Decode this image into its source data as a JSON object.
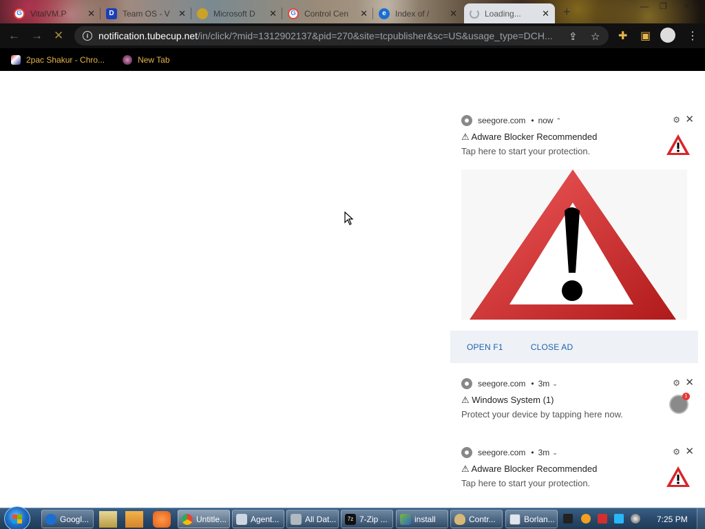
{
  "tabs": [
    {
      "title": "VitalVM.P",
      "favicon": "google-icon"
    },
    {
      "title": "Team OS - V",
      "favicon": "d-icon"
    },
    {
      "title": "Microsoft D",
      "favicon": "coin-icon"
    },
    {
      "title": "Control Cen",
      "favicon": "google-icon"
    },
    {
      "title": "Index of /",
      "favicon": "ie-icon"
    },
    {
      "title": "Loading...",
      "favicon": "spinner-icon",
      "active": true
    }
  ],
  "window_controls": {
    "minimize": "—",
    "restore": "❐",
    "close": "✕"
  },
  "address": {
    "host": "notification.tubecup.net",
    "path": "/in/click/?mid=1312902137&pid=270&site=tcpublisher&sc=US&usage_type=DCH..."
  },
  "bookmarks": [
    {
      "label": "2pac Shakur - Chro...",
      "icon": "photo-icon"
    },
    {
      "label": "New Tab",
      "icon": "globe-icon"
    }
  ],
  "notifications": [
    {
      "site": "seegore.com",
      "time": "now",
      "caret": "⌃",
      "title": "⚠ Adware Blocker Recommended",
      "body": "Tap here to start your protection.",
      "icon": "warning-triangle-icon",
      "expanded": true,
      "actions": [
        "OPEN F1",
        "CLOSE AD"
      ]
    },
    {
      "site": "seegore.com",
      "time": "3m",
      "caret": "⌄",
      "title": "⚠ Windows System (1)",
      "body": "Protect your device by tapping here now.",
      "icon": "settings-badge-icon",
      "badge": "1"
    },
    {
      "site": "seegore.com",
      "time": "3m",
      "caret": "⌄",
      "title": "⚠ Adware Blocker Recommended",
      "body": "Tap here to start your protection.",
      "icon": "warning-triangle-icon"
    }
  ],
  "taskbar": {
    "items": [
      {
        "label": "Googl...",
        "icon": "ie-icon"
      },
      {
        "label": "Untitle...",
        "icon": "chrome-icon"
      },
      {
        "label": "Agent...",
        "icon": "window-icon"
      },
      {
        "label": "All Dat...",
        "icon": "drive-icon"
      },
      {
        "label": "7-Zip ...",
        "icon": "7zip-icon"
      },
      {
        "label": "install",
        "icon": "installer-icon"
      },
      {
        "label": "Contr...",
        "icon": "shield-icon"
      },
      {
        "label": "Borlan...",
        "icon": "borland-icon"
      }
    ],
    "clock": "7:25 PM"
  },
  "colors": {
    "toolbar_bg": "#111111",
    "bookmark_text": "#e8b44a",
    "action_link": "#1a62b4",
    "warning_red": "#d8262b",
    "taskbar": "#2a4a6c"
  }
}
